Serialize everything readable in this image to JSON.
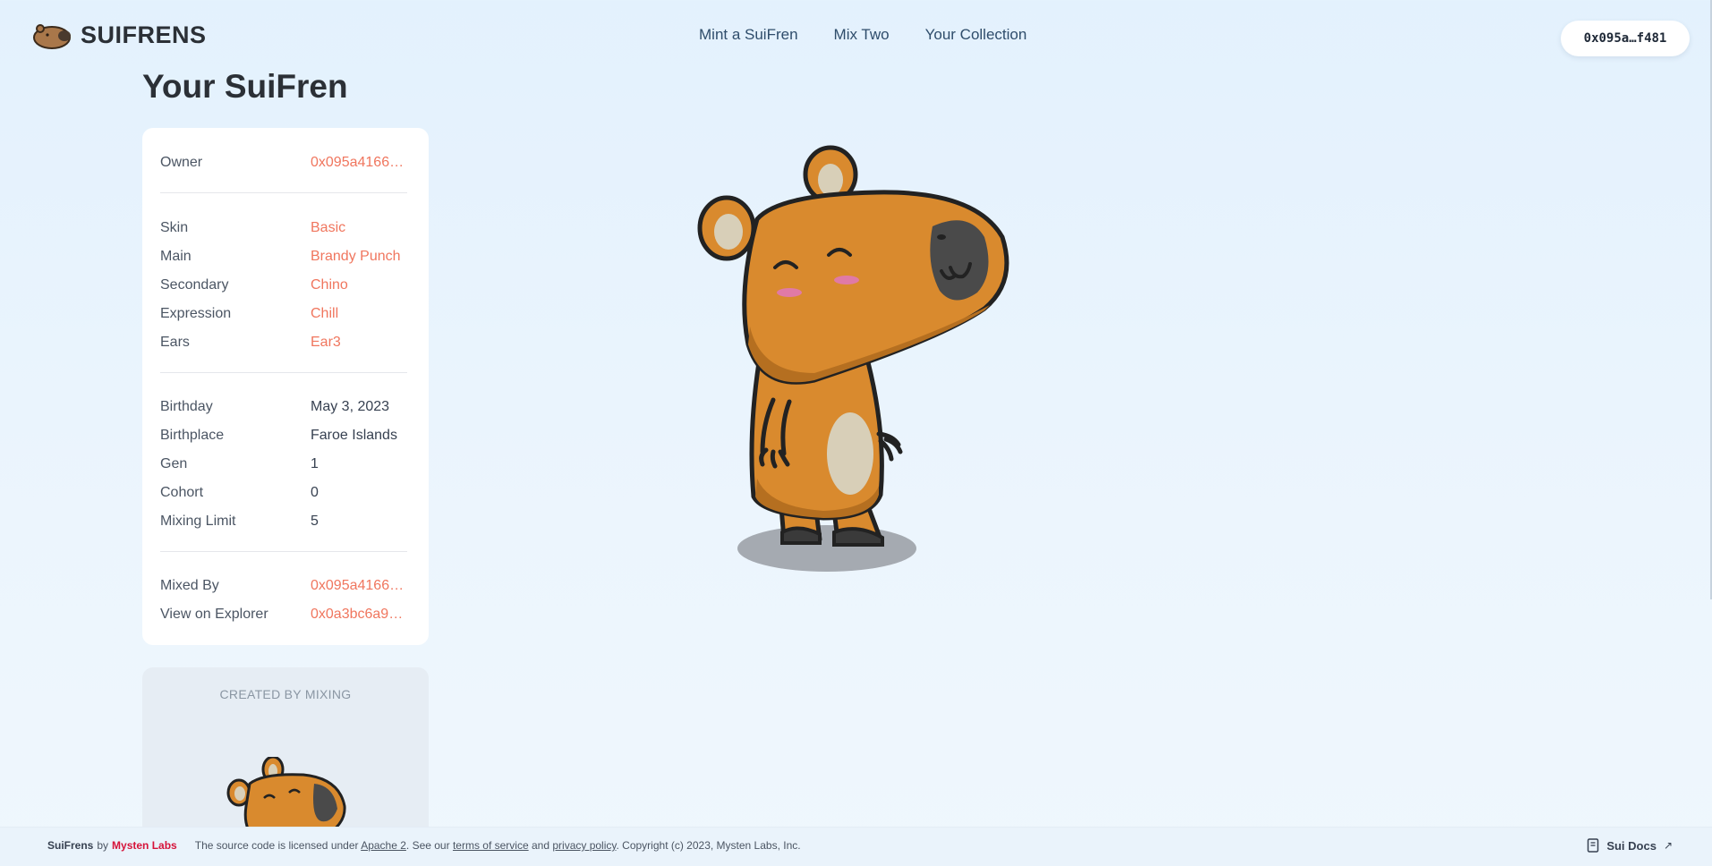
{
  "header": {
    "logo_text": "SUIFRENS",
    "nav": [
      {
        "label": "Mint a SuiFren"
      },
      {
        "label": "Mix Two"
      },
      {
        "label": "Your Collection"
      }
    ],
    "wallet": "0x095a…f481"
  },
  "page": {
    "title": "Your SuiFren"
  },
  "details": {
    "owner": {
      "label": "Owner",
      "value": "0x095a4166…"
    },
    "traits": [
      {
        "label": "Skin",
        "value": "Basic"
      },
      {
        "label": "Main",
        "value": "Brandy Punch"
      },
      {
        "label": "Secondary",
        "value": "Chino"
      },
      {
        "label": "Expression",
        "value": "Chill"
      },
      {
        "label": "Ears",
        "value": "Ear3"
      }
    ],
    "info": [
      {
        "label": "Birthday",
        "value": "May 3, 2023"
      },
      {
        "label": "Birthplace",
        "value": "Faroe Islands"
      },
      {
        "label": "Gen",
        "value": "1"
      },
      {
        "label": "Cohort",
        "value": "0"
      },
      {
        "label": "Mixing Limit",
        "value": "5"
      }
    ],
    "links": [
      {
        "label": "Mixed By",
        "value": "0x095a4166…"
      },
      {
        "label": "View on Explorer",
        "value": "0x0a3bc6a9c…"
      }
    ]
  },
  "mixing": {
    "label": "CREATED BY MIXING"
  },
  "footer": {
    "brand": "SuiFrens",
    "by": "by",
    "company": "Mysten Labs",
    "license_prefix": "The source code is licensed under",
    "license_link": "Apache 2",
    "see_our": ". See our",
    "terms": "terms of service",
    "and": "and",
    "privacy": "privacy policy",
    "copyright": ". Copyright (c) 2023, Mysten Labs, Inc.",
    "docs": "Sui Docs",
    "docs_arrow": "↗"
  },
  "colors": {
    "accent": "#f0765e",
    "body": "#d98a2e",
    "outline": "#222222",
    "cheek": "#e07aa6",
    "belly": "#d8cfb8",
    "nose": "#4a4a4a",
    "brand_red": "#d6133a"
  }
}
